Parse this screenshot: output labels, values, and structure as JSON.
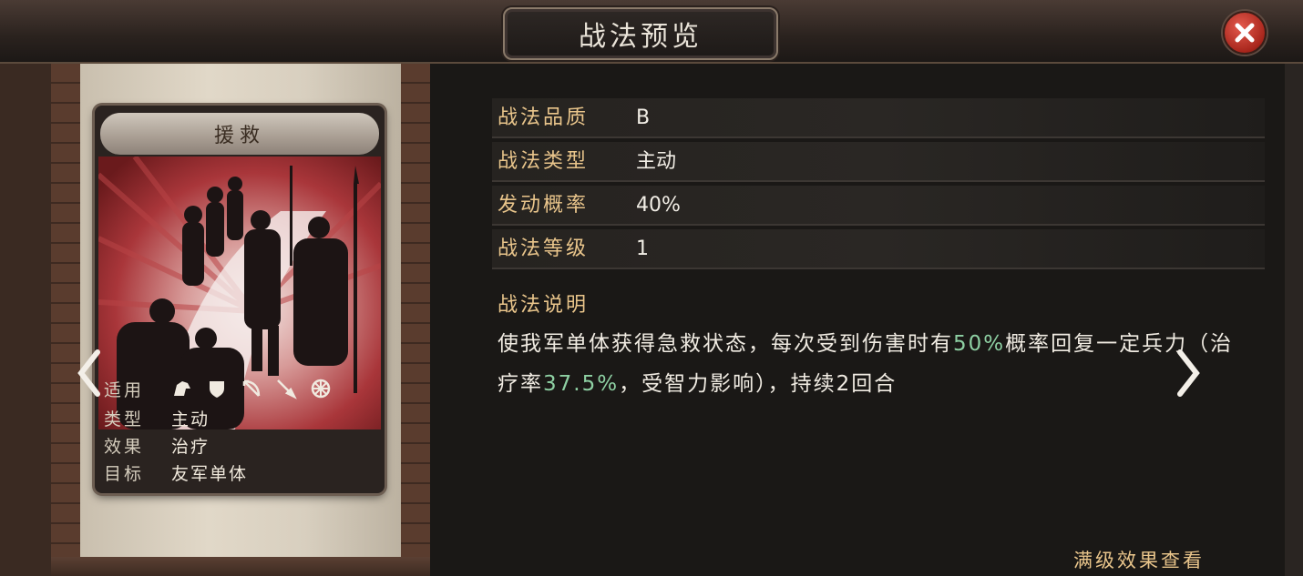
{
  "window": {
    "title": "战法预览"
  },
  "card": {
    "name": "援救",
    "rows": [
      {
        "label": "适用",
        "value": ""
      },
      {
        "label": "类型",
        "value": "主动"
      },
      {
        "label": "效果",
        "value": "治疗"
      },
      {
        "label": "目标",
        "value": "友军单体"
      }
    ],
    "troop_icons": [
      "cavalry-icon",
      "shield-icon",
      "bow-icon",
      "spear-icon",
      "wheel-icon"
    ]
  },
  "stats": [
    {
      "label": "战法品质",
      "value": "B"
    },
    {
      "label": "战法类型",
      "value": "主动"
    },
    {
      "label": "发动概率",
      "value": "40%"
    },
    {
      "label": "战法等级",
      "value": "1"
    }
  ],
  "description": {
    "title": "战法说明",
    "parts": [
      {
        "text": "使我军单体获得急救状态，每次受到伤害时有",
        "highlight": false
      },
      {
        "text": "50%",
        "highlight": true
      },
      {
        "text": "概率回复一定兵力（治疗率",
        "highlight": false
      },
      {
        "text": "37.5%",
        "highlight": true
      },
      {
        "text": "，受智力影响），持续2回合",
        "highlight": false
      }
    ]
  },
  "footer": {
    "full_level_label": "满级效果查看"
  },
  "colors": {
    "label_gold": "#e9c58b",
    "highlight_green": "#8ed0a3",
    "close_red": "#c8372b"
  }
}
